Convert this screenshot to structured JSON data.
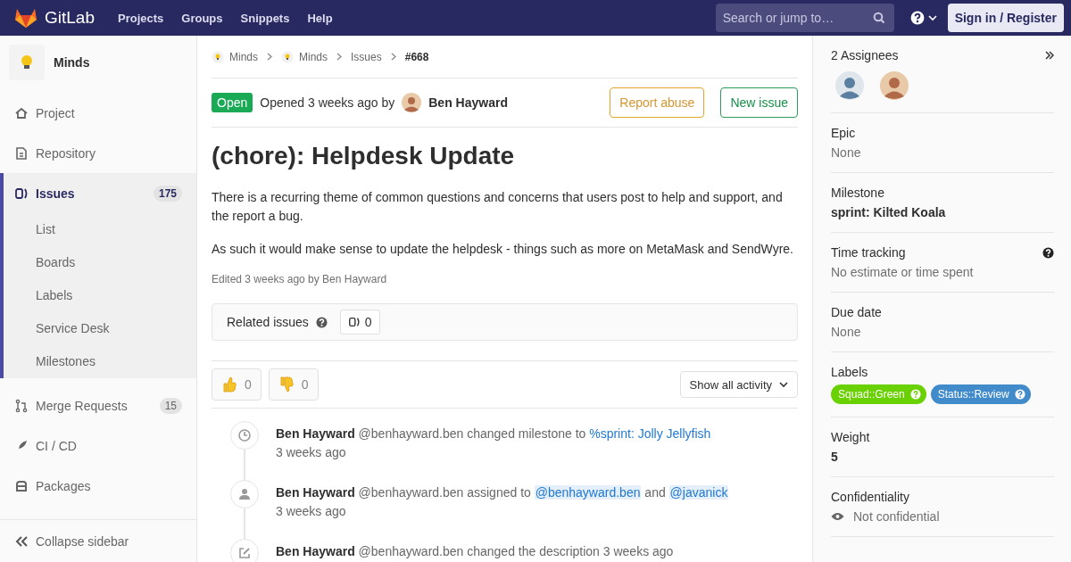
{
  "header": {
    "brand": "GitLab",
    "nav": [
      "Projects",
      "Groups",
      "Snippets",
      "Help"
    ],
    "search": {
      "placeholder": "Search or jump to…"
    },
    "sign_in": "Sign in / Register"
  },
  "sidebar": {
    "project": "Minds",
    "items": [
      {
        "label": "Project",
        "selected": false
      },
      {
        "label": "Repository",
        "selected": false
      },
      {
        "label": "Issues",
        "count": "175",
        "selected": true,
        "children": [
          "List",
          "Boards",
          "Labels",
          "Service Desk",
          "Milestones"
        ]
      },
      {
        "label": "Merge Requests",
        "count": "15",
        "selected": false
      },
      {
        "label": "CI / CD",
        "selected": false
      },
      {
        "label": "Packages",
        "selected": false
      }
    ],
    "collapse": "Collapse sidebar"
  },
  "breadcrumbs": [
    {
      "kind": "project",
      "label": "Minds"
    },
    {
      "kind": "project",
      "label": "Minds"
    },
    {
      "kind": "link",
      "label": "Issues"
    },
    {
      "kind": "current",
      "label": "#668"
    }
  ],
  "issue": {
    "status": "Open",
    "opened": "Opened 3 weeks ago by",
    "author": "Ben Hayward",
    "author_avatar": {
      "kind": "picture"
    },
    "actions": [
      {
        "kind": "warning",
        "label": "Report abuse"
      },
      {
        "kind": "success",
        "label": "New issue"
      }
    ],
    "title": "(chore): Helpdesk Update",
    "paragraphs": [
      "There is a recurring theme of common questions and concerns that users post to help and support, and the report a bug.",
      "As such it would make sense to update the helpdesk - things such as more on MetaMask and SendWyre."
    ],
    "edited": "Edited 3 weeks ago by Ben Hayward",
    "related": {
      "label": "Related issues",
      "count": "0"
    },
    "awards": [
      {
        "kind": "thumbsup",
        "count": "0"
      },
      {
        "kind": "thumbsdown",
        "count": "0"
      }
    ],
    "filter": "Show all activity",
    "notes": [
      {
        "kind": "clock",
        "author": "Ben Hayward",
        "parts": [
          {
            "kind": "text",
            "text": "@benhayward.ben changed milestone to "
          },
          {
            "kind": "link",
            "text": "%sprint: Jolly Jellyfish"
          }
        ],
        "time": "3 weeks ago"
      },
      {
        "kind": "person",
        "author": "Ben Hayward",
        "parts": [
          {
            "kind": "text",
            "text": "@benhayward.ben assigned to "
          },
          {
            "kind": "mention",
            "text": "@benhayward.ben"
          },
          {
            "kind": "text",
            "text": " and "
          },
          {
            "kind": "mention",
            "text": "@javanick"
          }
        ],
        "time": "3 weeks ago"
      },
      {
        "kind": "pencil",
        "author": "Ben Hayward",
        "parts": [
          {
            "kind": "text",
            "text": "@benhayward.ben changed the description 3 weeks ago"
          }
        ]
      }
    ]
  },
  "right": {
    "assignees": {
      "title": "2 Assignees",
      "avatars": [
        {
          "kind": "picture"
        },
        {
          "kind": "picture"
        }
      ]
    },
    "sections": [
      {
        "kind": "plain",
        "title": "Epic",
        "value": "None"
      },
      {
        "kind": "strong",
        "title": "Milestone",
        "value": "sprint: Kilted Koala"
      },
      {
        "kind": "help",
        "title": "Time tracking",
        "value": "No estimate or time spent"
      },
      {
        "kind": "plain",
        "title": "Due date",
        "value": "None"
      },
      {
        "kind": "labels",
        "title": "Labels",
        "labels": [
          {
            "text": "Squad::Green",
            "color": "#69d100"
          },
          {
            "text": "Status::Review",
            "color": "#428bca"
          }
        ]
      },
      {
        "kind": "strong",
        "title": "Weight",
        "value": "5"
      },
      {
        "kind": "eye",
        "title": "Confidentiality",
        "value": "Not confidential"
      }
    ]
  }
}
